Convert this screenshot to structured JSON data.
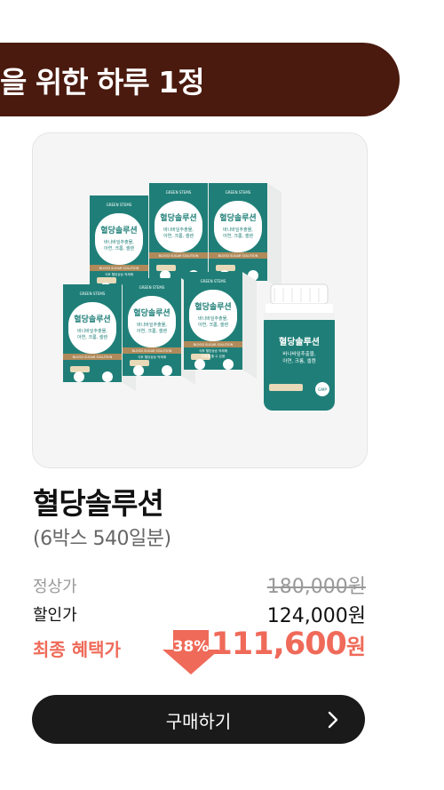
{
  "banner": {
    "text": "을 위한 하루 1정"
  },
  "product": {
    "name": "혈당솔루션",
    "subtitle": "(6박스 540일분)",
    "image": {
      "brand_line": "GREEN STEMS",
      "box_title": "혈당솔루션",
      "box_desc_1": "바나바잎추출물,",
      "box_desc_2": "아연, 크롬, 셀렌",
      "box_band": "BLOOD SUGAR SOLUTION",
      "box_foot_1": "식후 혈당상승 억제에",
      "box_foot_2": "도움을 줄 수 있음",
      "bottle_title": "혈당솔루션",
      "bottle_desc_1": "바나바잎추출물,",
      "bottle_desc_2": "아연, 크롬, 셀렌",
      "badge": "GMP"
    }
  },
  "prices": {
    "regular_label": "정상가",
    "regular_value": "180,000원",
    "sale_label": "할인가",
    "sale_value": "124,000원",
    "final_label": "최종 혜택가",
    "discount": "38%",
    "final_value": "111,600",
    "final_unit": "원"
  },
  "buy_button": {
    "label": "구매하기",
    "icon": "chevron-right-icon"
  },
  "colors": {
    "banner": "#4a1a0e",
    "accent": "#ef6a59",
    "teal": "#1f7f78",
    "button": "#1a1a1a"
  }
}
